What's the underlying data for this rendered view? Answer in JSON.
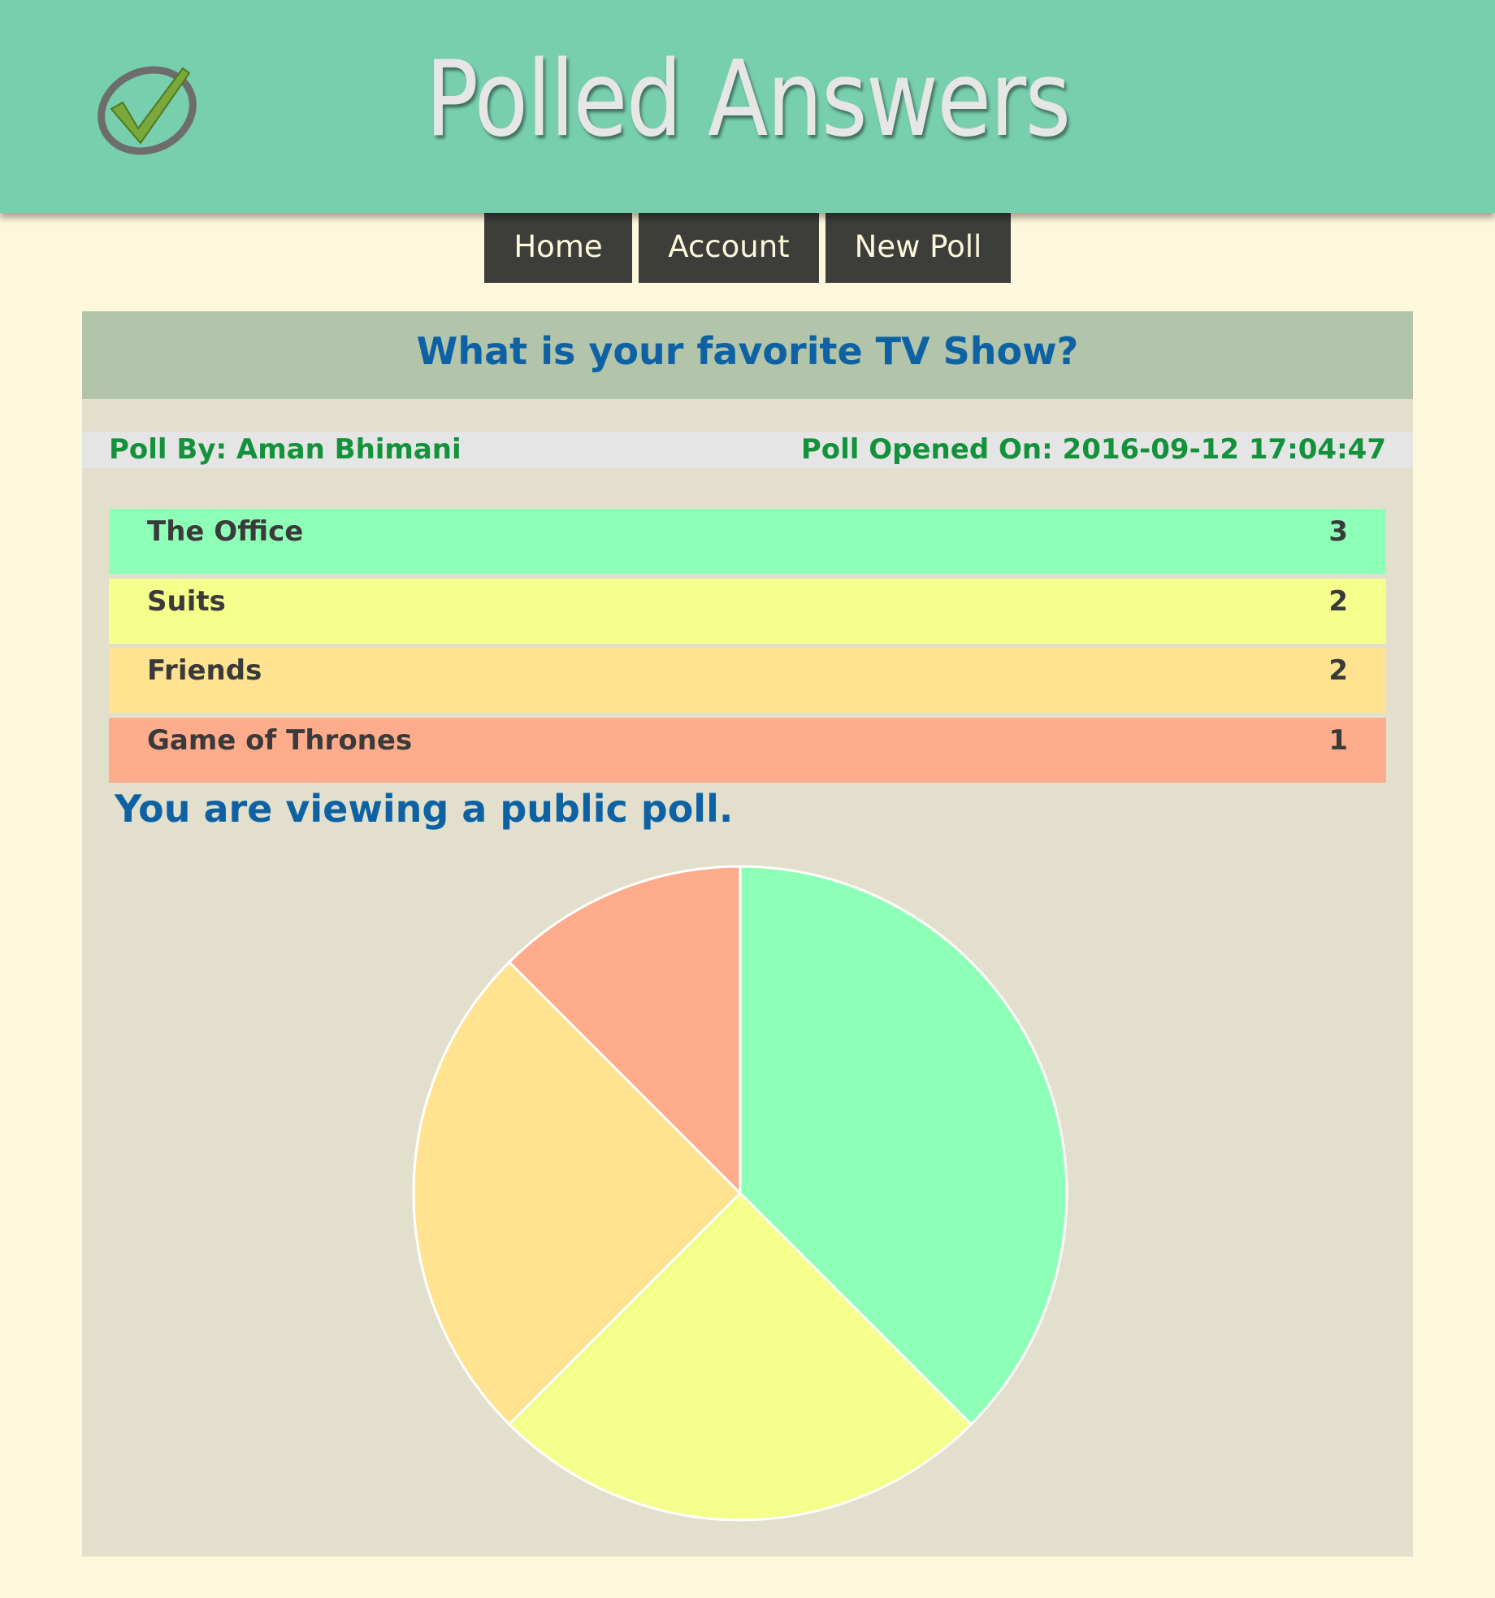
{
  "header": {
    "title": "Polled Answers",
    "logo_icon": "checkmark-logo-icon"
  },
  "nav": {
    "home": "Home",
    "account": "Account",
    "new_poll": "New Poll"
  },
  "poll": {
    "question": "What is your favorite TV Show?",
    "author": "Poll By: Aman Bhimani",
    "opened": "Poll Opened On: 2016-09-12 17:04:47",
    "options": [
      {
        "label": "The Office",
        "count": "3",
        "color": "#8effb6"
      },
      {
        "label": "Suits",
        "count": "2",
        "color": "#f4ff8c"
      },
      {
        "label": "Friends",
        "count": "2",
        "color": "#ffe391"
      },
      {
        "label": "Game of Thrones",
        "count": "1",
        "color": "#ffac8c"
      }
    ],
    "visibility_note": "You are viewing a public poll."
  },
  "chart_data": {
    "type": "pie",
    "categories": [
      "The Office",
      "Suits",
      "Friends",
      "Game of Thrones"
    ],
    "values": [
      3,
      2,
      2,
      1
    ],
    "colors": [
      "#8effb6",
      "#f4ff8c",
      "#ffe391",
      "#ffac8c"
    ],
    "title": "",
    "legend": "none"
  },
  "colors": {
    "header_bg": "#77cfad",
    "page_bg": "#fdf8dc",
    "card_bg": "#e2e0cc",
    "title_bar_bg": "#b2c4a9",
    "accent_blue": "#0e62a3",
    "accent_green": "#13913b",
    "nav_bg": "#3d3d3a"
  }
}
